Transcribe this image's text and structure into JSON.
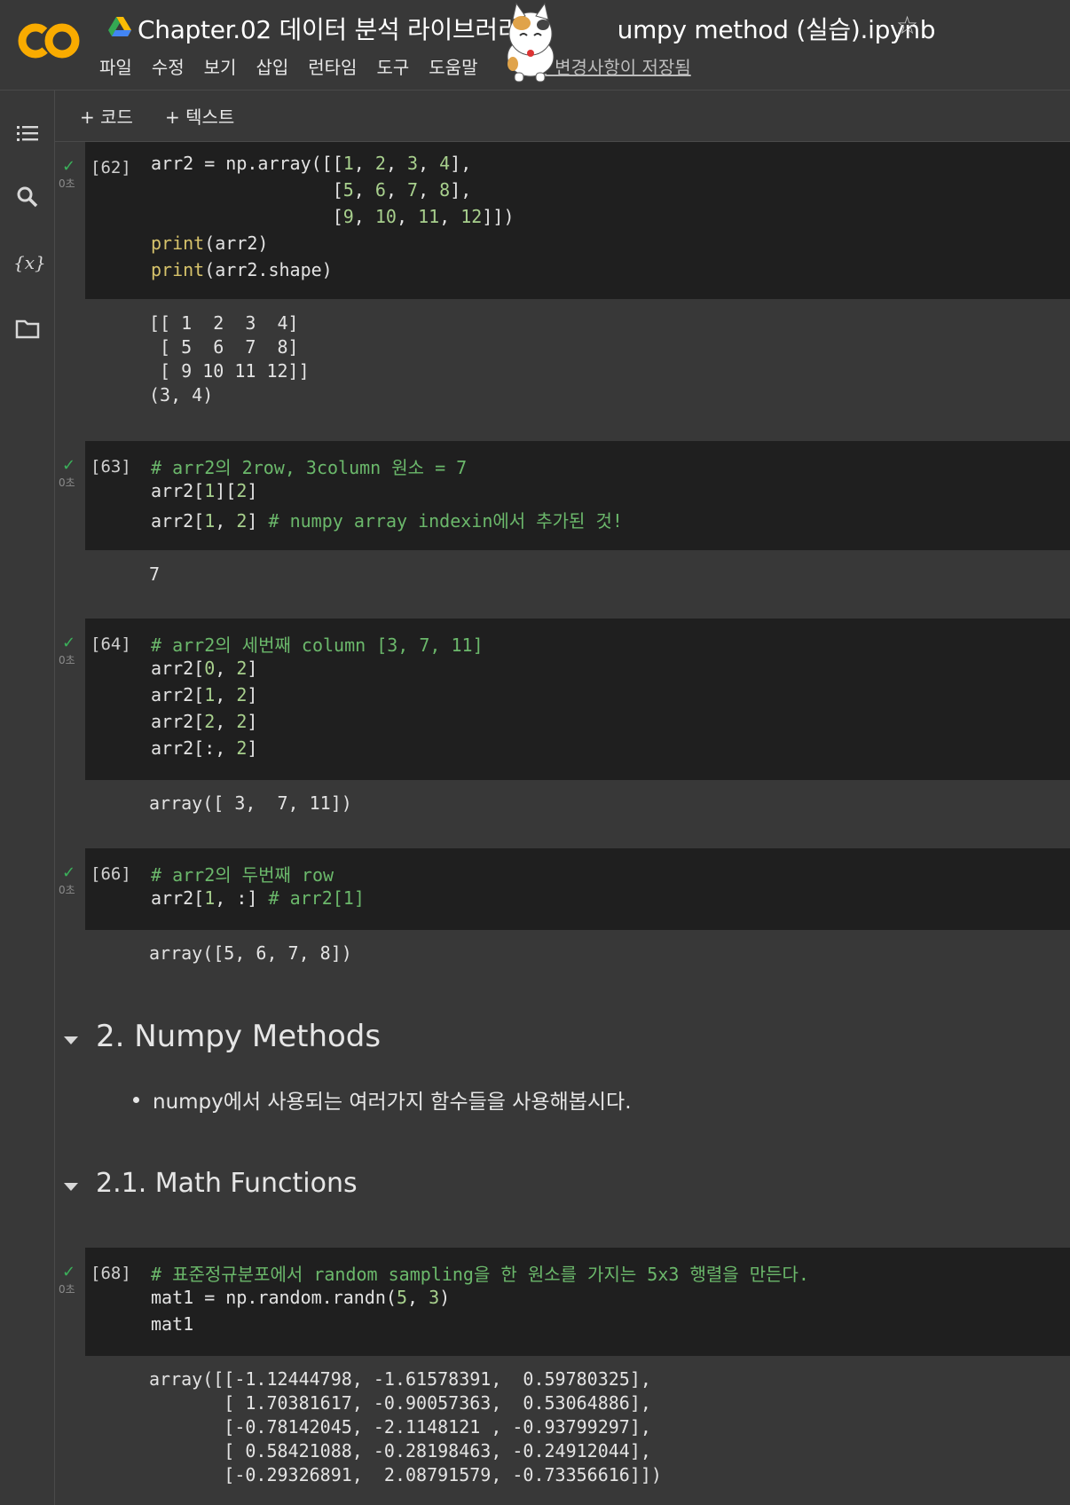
{
  "header": {
    "title": "Chapter.02 데이터 분석 라이브러리-03. Numpy method (실습).ipynb",
    "title_visible_left": "Chapter.02 데이터 분석 라이브러리-0",
    "title_visible_right": "umpy method (실습).ipynb",
    "menu": [
      "파일",
      "수정",
      "보기",
      "삽입",
      "런타임",
      "도구",
      "도움말"
    ],
    "save_status": "모든 변경사항이 저장됨",
    "logo_text": "CO",
    "colors": {
      "logo_orange": "#f9ab00",
      "check_green": "#3bb05a"
    }
  },
  "sidebar": {
    "icons": [
      "toc-icon",
      "search-icon",
      "variables-icon",
      "folder-icon"
    ],
    "variables_label": "{x}"
  },
  "toolbar": {
    "add_code": "+ 코드",
    "add_text": "+ 텍스트"
  },
  "cells": [
    {
      "count": "[62]",
      "time": "0초",
      "code": [
        "arr2 = np.array([[1, 2, 3, 4],",
        "                 [5, 6, 7, 8],",
        "                 [9, 10, 11, 12]])",
        "print(arr2)",
        "print(arr2.shape)"
      ],
      "output": [
        "[[ 1  2  3  4]",
        " [ 5  6  7  8]",
        " [ 9 10 11 12]]",
        "(3, 4)"
      ]
    },
    {
      "count": "[63]",
      "time": "0초",
      "code": [
        "# arr2의 2row, 3column 원소 = 7",
        "arr2[1][2]",
        "arr2[1, 2] # numpy array indexin에서 추가된 것!"
      ],
      "output": [
        "7"
      ]
    },
    {
      "count": "[64]",
      "time": "0초",
      "code": [
        "# arr2의 세번째 column [3, 7, 11]",
        "arr2[0, 2]",
        "arr2[1, 2]",
        "arr2[2, 2]",
        "arr2[:, 2]"
      ],
      "output": [
        "array([ 3,  7, 11])"
      ]
    },
    {
      "count": "[66]",
      "time": "0초",
      "code": [
        "# arr2의 두번째 row",
        "arr2[1, :] # arr2[1]"
      ],
      "output": [
        "array([5, 6, 7, 8])"
      ]
    },
    {
      "count": "[68]",
      "time": "0초",
      "code": [
        "# 표준정규분포에서 random sampling을 한 원소를 가지는 5x3 행렬을 만든다.",
        "mat1 = np.random.randn(5, 3)",
        "mat1"
      ],
      "output": [
        "array([[-1.12444798, -1.61578391,  0.59780325],",
        "       [ 1.70381617, -0.90057363,  0.53064886],",
        "       [-0.78142045, -2.1148121 , -0.93799297],",
        "       [ 0.58421088, -0.28198463, -0.24912044],",
        "       [-0.29326891,  2.08791579, -0.73356616]])"
      ]
    }
  ],
  "markdown": {
    "section_2": "2. Numpy Methods",
    "section_2_bullet": "numpy에서 사용되는 여러가지 함수들을 사용해봅시다.",
    "section_2_1": "2.1. Math Functions"
  }
}
